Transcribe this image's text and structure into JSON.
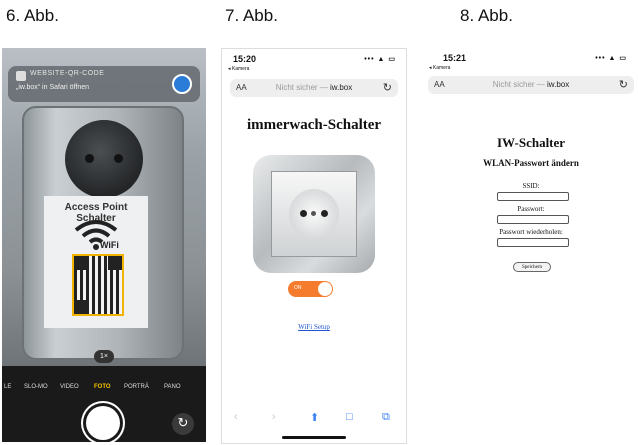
{
  "figures": [
    {
      "label": "6. Abb."
    },
    {
      "label": "7. Abb."
    },
    {
      "label": "8. Abb."
    }
  ],
  "camera": {
    "notification": {
      "title": "WEBSITE-QR-CODE",
      "subtitle": "„iw.box“ in Safari öffnen"
    },
    "sticker_title": "Access Point Schalter",
    "wifi_text": "WiFi",
    "zoom": "1×",
    "modes": [
      "LE",
      "SLO-MO",
      "VIDEO",
      "FOTO",
      "PORTRÄ",
      "PANO"
    ],
    "active_mode": "FOTO"
  },
  "phone2": {
    "time": "15:20",
    "back": "◂ Kamera",
    "status_icons": "••• ▲ ▭",
    "url_aa": "AA",
    "url_prefix": "Nicht sicher — ",
    "url_host": "iw.box",
    "reload": "↻",
    "heading": "immerwach-Schalter",
    "toggle_text": "ON",
    "wifi_link": "WiFi Setup",
    "toolbar": {
      "back": "‹",
      "forward": "›",
      "share": "⬆",
      "bookmarks": "□",
      "tabs": "⧉"
    }
  },
  "phone3": {
    "time": "15:21",
    "back": "◂ Kamera",
    "status_icons": "••• ▲ ▭",
    "url_aa": "AA",
    "url_prefix": "Nicht sicher — ",
    "url_host": "iw.box",
    "reload": "↻",
    "heading": "IW-Schalter",
    "subheading": "WLAN-Passwort ändern",
    "ssid_label": "SSID:",
    "password_label": "Passwort:",
    "password_repeat_label": "Passwort wiederholen:",
    "save_button": "Speichern"
  }
}
